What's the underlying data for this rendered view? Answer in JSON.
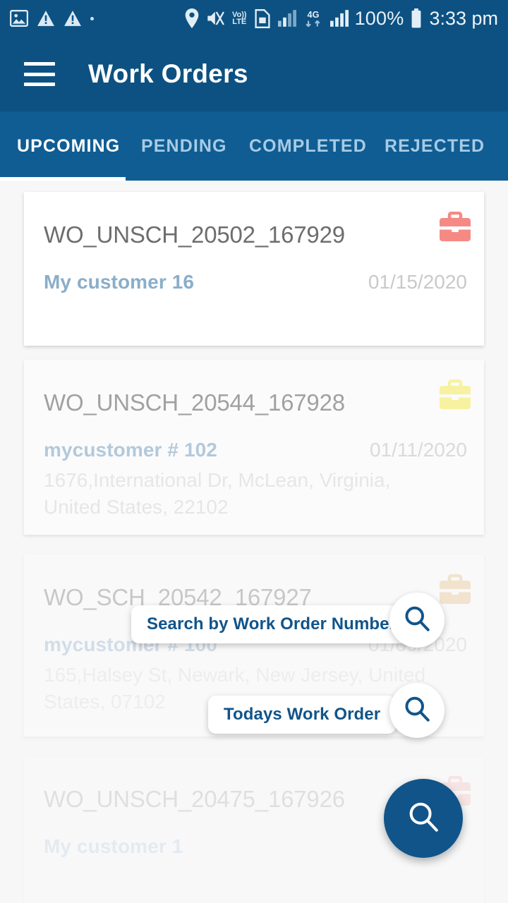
{
  "status_bar": {
    "left_icons": [
      {
        "name": "photo-icon"
      },
      {
        "name": "warning-triangle-icon"
      },
      {
        "name": "warning-triangle-icon-2"
      },
      {
        "name": "small-dot-indicator"
      }
    ],
    "right_icons": [
      {
        "name": "location-pin-icon"
      },
      {
        "name": "sound-vibrate-off-icon"
      },
      {
        "name": "volte-icon",
        "line1": "Vo))",
        "line2": "LTE"
      },
      {
        "name": "sim-card-icon"
      },
      {
        "name": "signal-bars-icon-1"
      },
      {
        "name": "network-4g-icon",
        "label": "4G"
      },
      {
        "name": "signal-bars-icon-2"
      }
    ],
    "battery_percent": "100%",
    "time": "3:33 pm"
  },
  "app_bar": {
    "menu_icon": "hamburger-menu-icon",
    "title": "Work Orders"
  },
  "tabs": {
    "active_index": 0,
    "items": [
      {
        "label": "UPCOMING"
      },
      {
        "label": "PENDING"
      },
      {
        "label": "COMPLETED"
      },
      {
        "label": "REJECTED"
      }
    ]
  },
  "work_orders": [
    {
      "number": "WO_UNSCH_20502_167929",
      "customer": "My customer 16",
      "date": "01/15/2020",
      "address": "",
      "badge_icon": "briefcase-icon",
      "badge_color": "#f58a85"
    },
    {
      "number": "WO_UNSCH_20544_167928",
      "customer": "mycustomer # 102",
      "date": "01/11/2020",
      "address": "1676,International Dr, McLean, Virginia, United States, 22102",
      "badge_icon": "briefcase-icon",
      "badge_color": "#f7f06a"
    },
    {
      "number": "WO_SCH_20542_167927",
      "customer": "mycustomer # 100",
      "date": "01/09/2020",
      "address": "165,Halsey St, Newark, New Jersey, United States, 07102",
      "badge_icon": "briefcase-icon",
      "badge_color": "#f3d9a8"
    },
    {
      "number": "WO_UNSCH_20475_167926",
      "customer": "My customer 1",
      "date": "",
      "address": "",
      "badge_icon": "briefcase-icon",
      "badge_color": "#f7c9c6"
    }
  ],
  "speed_dial": {
    "main_fab_icon": "search-icon",
    "actions": [
      {
        "label": "Search by Work Order Number",
        "icon": "search-icon"
      },
      {
        "label": "Todays Work Order",
        "icon": "search-icon"
      }
    ]
  },
  "colors": {
    "primary": "#0d5182",
    "tab_bar": "#0f5d93",
    "fab": "#11548a",
    "label_text": "#11548a",
    "background": "#f7f7f8"
  }
}
